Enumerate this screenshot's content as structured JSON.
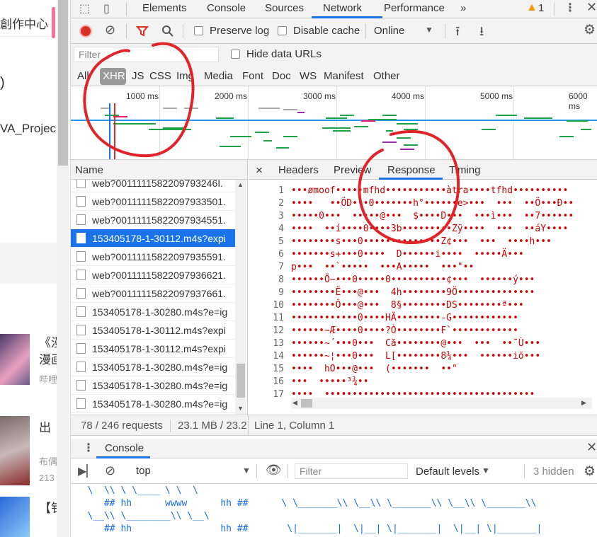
{
  "left_panel": {
    "item1": "創作中心",
    "item2": ")",
    "item3": "VA_Projec",
    "card1_title": "《漫",
    "card1_line2": "漫画",
    "card1_sub": "哔哩",
    "card2_title": "出",
    "card2_sub": "布偶",
    "card2_num": "213",
    "card3_title": "【钅"
  },
  "devtools": {
    "tabs": [
      "Elements",
      "Console",
      "Sources",
      "Network",
      "Performance"
    ],
    "active_tab": "Network",
    "more_tabs": "»",
    "warning_count": "1",
    "toolbar": {
      "preserve_log": "Preserve log",
      "disable_cache": "Disable cache",
      "throttle": "Online"
    },
    "filter_placeholder": "Filter",
    "hide_data_urls": "Hide data URLs",
    "types": [
      "All",
      "XHR",
      "JS",
      "CSS",
      "Img",
      "Media",
      "Font",
      "Doc",
      "WS",
      "Manifest",
      "Other"
    ],
    "active_type": "XHR",
    "timeline_ticks": [
      "1000 ms",
      "2000 ms",
      "3000 ms",
      "4000 ms",
      "5000 ms",
      "6000 ms"
    ],
    "names_header": "Name",
    "requests": [
      "web?0011111582209793246I.",
      "web?00111115822097933501.",
      "web?00111115822097934551.",
      "153405178-1-30112.m4s?expi",
      "web?00111115822097935591.",
      "web?00111115822097936621.",
      "web?00111115822097937661.",
      "153405178-1-30280.m4s?e=ig",
      "153405178-1-30112.m4s?expi",
      "153405178-1-30112.m4s?expi",
      "153405178-1-30280.m4s?e=ig",
      "153405178-1-30280.m4s?e=ig",
      "153405178-1-30280.m4s?e=ig"
    ],
    "selected_request": "153405178-1-30112.m4s?expi",
    "detail_tabs": [
      "Headers",
      "Preview",
      "Response",
      "Timing"
    ],
    "active_detail_tab": "Response",
    "close_glyph": "×",
    "response_lines": [
      "•••ømoof•••••mfhd•••••••••••àtra••••tfhd••••••••••",
      "••••   ••ÖD•••0•••••••h°••••••e>•••  •••  ••Ö•••Ð••",
      "•••••0•••  •••••@•••  $••••D•••  •••ì•••  ••7••••••",
      "••••  ••í••••0••••3b•••••••••Zÿ••••  •••  ••áY••••",
      "••••••••s•••0••••••••••••••Z¢•••  •••  ••••h•••",
      "•••••••s+•••0••••  D••••••i••••  •••••Ä•••",
      "p•••  ••`•••••  •••A•••••  •••\"••",
      "••••••Ö~•••0•••••0••••••••••¢•••  ••••••ý•••",
      "••••••••Ë•••@•••  4h••••••••9Ö••••••••••••••",
      "••••••••Ô•••@•••  8§••••••••DS••••••••ª•••",
      "••••••••••••0••••HÄ••••••••-G••••••••••••",
      "••••••~Æ••••0••••?Ò••••••••F`••••••••••••",
      "••••••~´•••0•••  Cã••••••••@•••  •••  ••¯Ù•••",
      "••••••~¦•••0•••  L[••••••••8¾•••  ••••••iö•••",
      "••••  hO•••@•••  (•••••••  ••\"",
      "•••  •••••³¾••",
      "••••  ••••••••••••••••••••••••••••••••••••••",
      "••••••••••••••••••••••••••••••••••••••••••••"
    ],
    "status": {
      "requests": "78 / 246 requests",
      "size": "23.1 MB / 23.2",
      "cursor": "Line 1, Column 1"
    },
    "drawer": {
      "title": "Console",
      "context": "top",
      "filter_placeholder": "Filter",
      "levels": "Default levels",
      "hidden": "3 hidden"
    },
    "console_lines": [
      "   \\  \\\\ \\ \\____ \\ \\  \\",
      "      ## hh      wwww      hh ##      \\ \\_______\\\\ \\__\\\\ \\_______\\\\ \\__\\\\ \\_______\\\\",
      "   \\__\\\\ \\________\\\\ \\__\\",
      "      ## hh                hh ##       \\|_______|  \\|__| \\|_______|  \\|__| \\|_______|"
    ]
  },
  "colors": {
    "accent": "#1a73e8",
    "record": "#d93025",
    "filter_active": "#d93025",
    "annotation": "#e0242a",
    "timeline_blue": "#2196f3",
    "timeline_green": "#1ea446"
  }
}
